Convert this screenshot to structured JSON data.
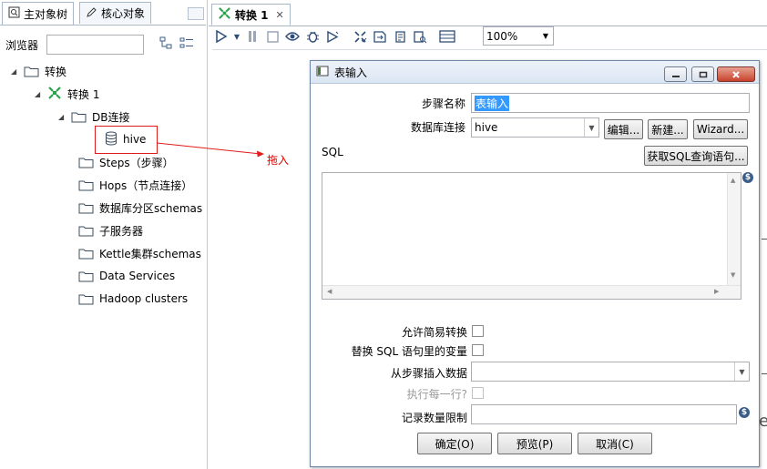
{
  "left_panel": {
    "tabs": [
      {
        "label": "主对象树",
        "icon": "search-icon"
      },
      {
        "label": "核心对象",
        "icon": "pencil-icon"
      }
    ],
    "browser_label": "浏览器",
    "tree": {
      "root": "转换",
      "transform": "转换 1",
      "db_connections": "DB连接",
      "hive": "hive",
      "steps": "Steps（步骤）",
      "hops": "Hops（节点连接）",
      "partition_schemas": "数据库分区schemas",
      "slave_servers": "子服务器",
      "cluster_schemas": "Kettle集群schemas",
      "data_services": "Data Services",
      "hadoop_clusters": "Hadoop clusters"
    },
    "drag_annotation": "拖入"
  },
  "main": {
    "tab_label": "转换 1",
    "tab_close": "✕",
    "zoom": "100%"
  },
  "dialog": {
    "title": "表输入",
    "step_name_label": "步骤名称",
    "step_name_value": "表输入",
    "db_conn_label": "数据库连接",
    "db_conn_value": "hive",
    "edit_button": "编辑...",
    "new_button": "新建...",
    "wizard_button": "Wizard...",
    "sql_label": "SQL",
    "get_sql_button": "获取SQL查询语句...",
    "allow_lazy_label": "允许简易转换",
    "replace_vars_label": "替换 SQL 语句里的变量",
    "insert_from_step_label": "从步骤插入数据",
    "exec_each_row_label": "执行每一行?",
    "limit_label": "记录数量限制",
    "ok_button": "确定(O)",
    "preview_button": "预览(P)",
    "cancel_button": "取消(C)"
  },
  "colors": {
    "accent_red": "#e21a1a",
    "title_blue": "#3a5d8a"
  }
}
